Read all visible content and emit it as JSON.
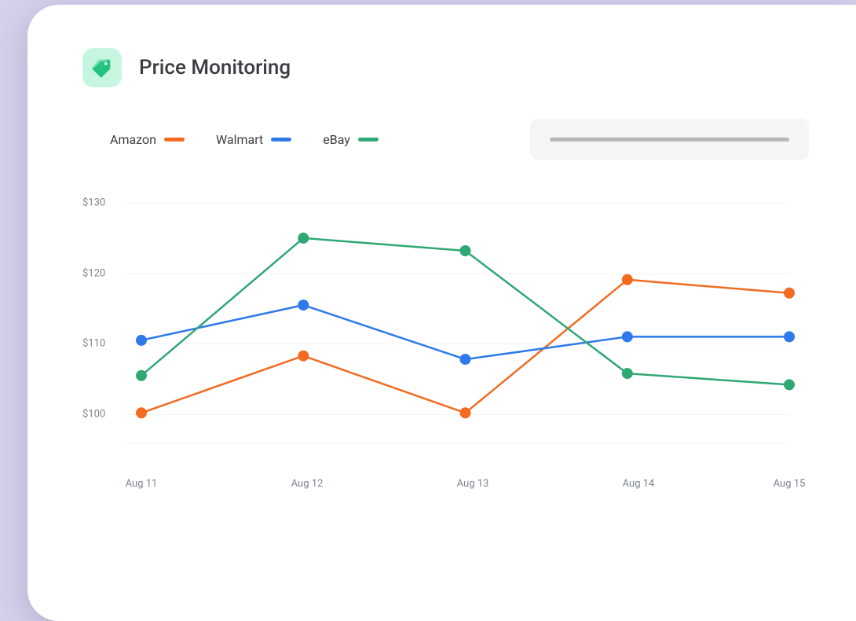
{
  "header": {
    "title": "Price Monitoring",
    "icon": "price-tag-icon"
  },
  "legend": [
    {
      "name": "Amazon",
      "color": "#f26b21"
    },
    {
      "name": "Walmart",
      "color": "#2f7aea"
    },
    {
      "name": "eBay",
      "color": "#2fa874"
    }
  ],
  "y_ticks": [
    "$130",
    "$120",
    "$110",
    "$100"
  ],
  "x_ticks": [
    "Aug 11",
    "Aug 12",
    "Aug 13",
    "Aug 14",
    "Aug 15"
  ],
  "chart_data": {
    "type": "line",
    "title": "Price Monitoring",
    "xlabel": "",
    "ylabel": "",
    "ylim": [
      96,
      130
    ],
    "categories": [
      "Aug 11",
      "Aug 12",
      "Aug 13",
      "Aug 14",
      "Aug 15"
    ],
    "series": [
      {
        "name": "Amazon",
        "color": "#f26b21",
        "values": [
          100.2,
          108.3,
          100.2,
          119.1,
          117.2
        ]
      },
      {
        "name": "Walmart",
        "color": "#2f7aea",
        "values": [
          110.5,
          115.5,
          107.8,
          111.0,
          111.0
        ]
      },
      {
        "name": "eBay",
        "color": "#2fa874",
        "values": [
          105.5,
          125.0,
          123.2,
          105.8,
          104.2
        ]
      }
    ]
  }
}
